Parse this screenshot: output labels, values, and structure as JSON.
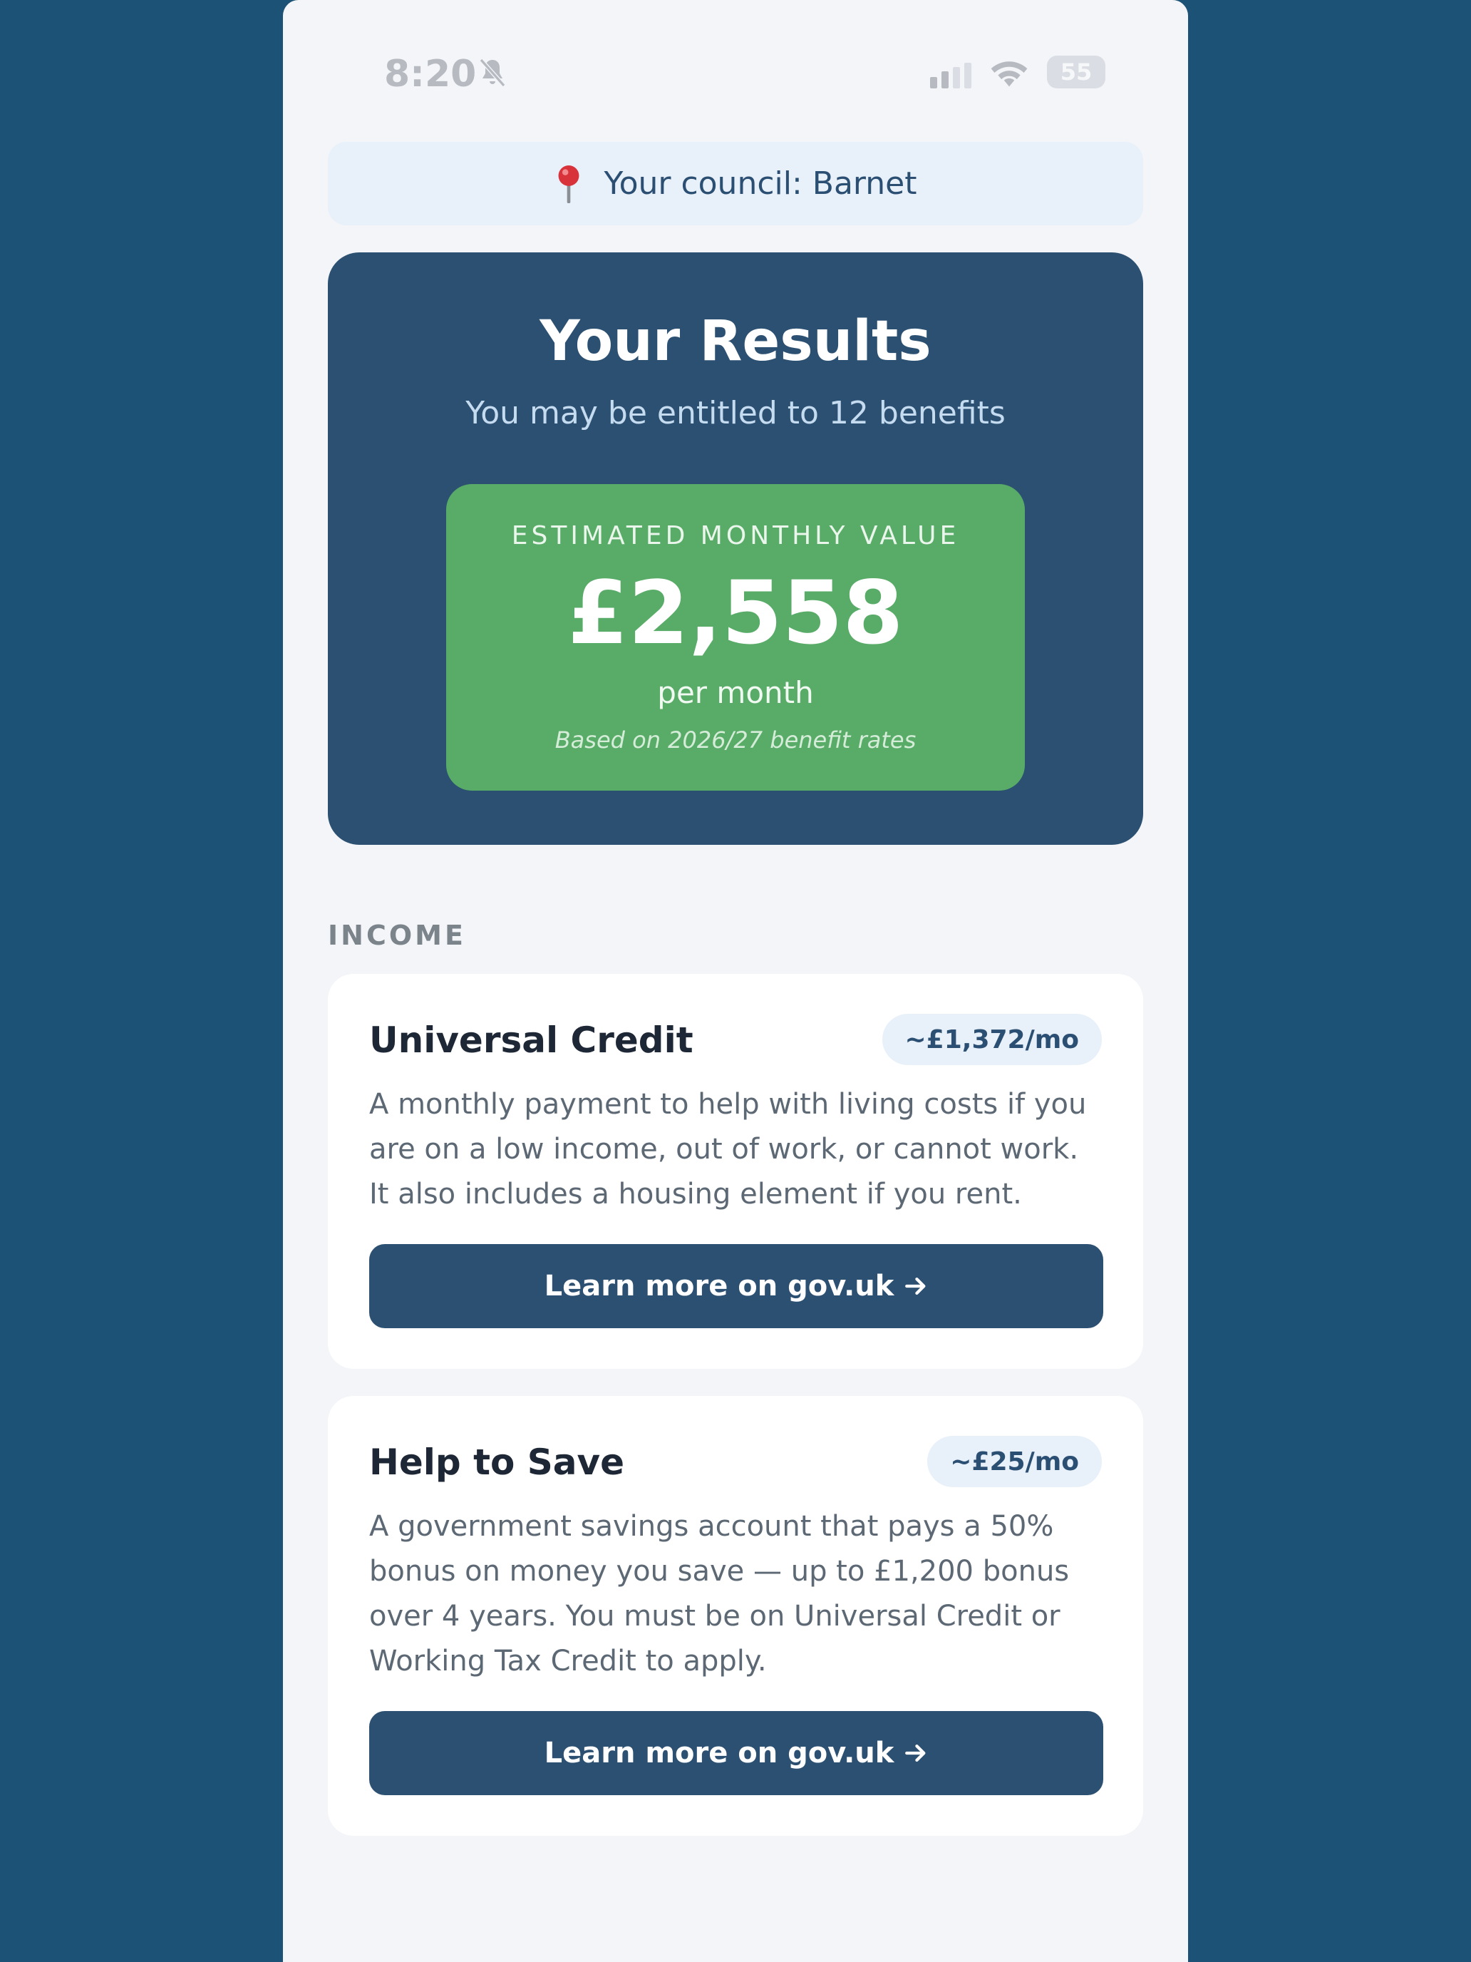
{
  "status_bar": {
    "time": "8:20",
    "battery": "55"
  },
  "council": {
    "text": "Your council: Barnet"
  },
  "results": {
    "title": "Your Results",
    "subtitle": "You may be entitled to 12 benefits",
    "estimate_label": "ESTIMATED MONTHLY VALUE",
    "estimate_amount": "£2,558",
    "estimate_period": "per month",
    "estimate_note": "Based on 2026/27 benefit rates"
  },
  "sections": {
    "income_heading": "INCOME"
  },
  "benefits": [
    {
      "title": "Universal Credit",
      "amount": "~£1,372/mo",
      "description": "A monthly payment to help with living costs if you are on a low income, out of work, or cannot work. It also includes a housing element if you rent.",
      "button_label": "Learn more on gov.uk"
    },
    {
      "title": "Help to Save",
      "amount": "~£25/mo",
      "description": "A government savings account that pays a 50% bonus on money you save — up to £1,200 bonus over 4 years. You must be on Universal Credit or Working Tax Credit to apply.",
      "button_label": "Learn more on gov.uk"
    }
  ],
  "colors": {
    "page_background": "#1c5275",
    "card_navy": "#2c5072",
    "estimate_green": "#58ac67",
    "badge_background": "#e8f0f9"
  },
  "icons": {
    "council": "pin-icon",
    "button": "arrow-right-icon",
    "status": [
      "bell-slash-icon",
      "signal-icon",
      "wifi-icon",
      "battery-icon"
    ]
  }
}
